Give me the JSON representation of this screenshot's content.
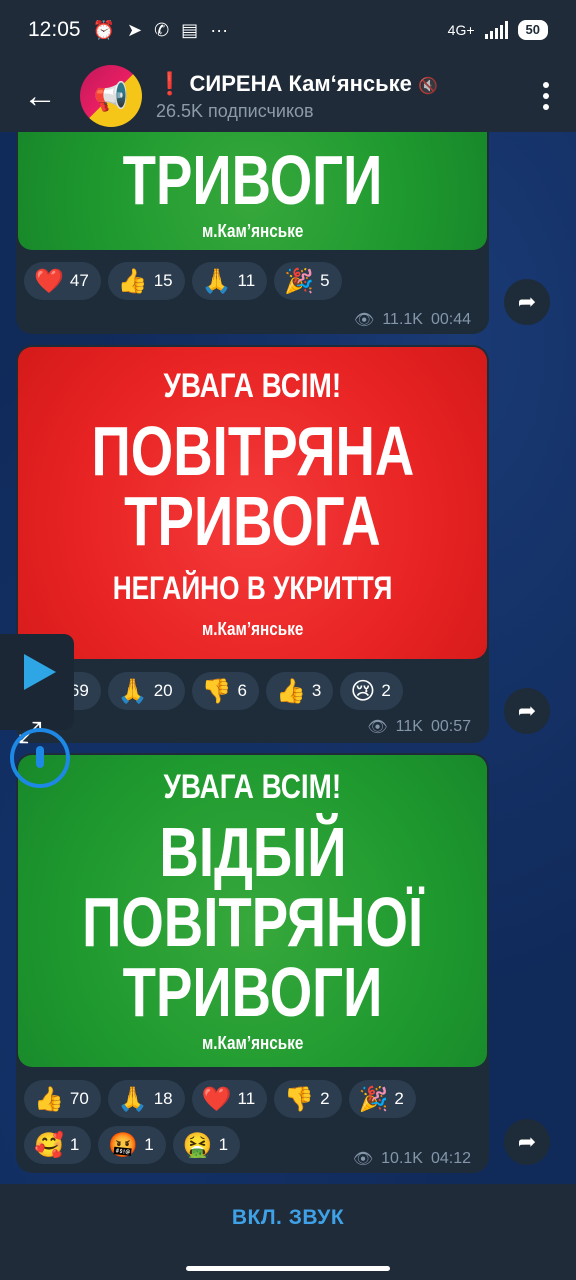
{
  "status_bar": {
    "time": "12:05",
    "icons": [
      "alarm-icon",
      "telegram-icon",
      "viber-icon",
      "news-icon",
      "more-dots-icon"
    ],
    "network": "4G+",
    "battery": "50"
  },
  "header": {
    "title_prefix": "❗",
    "title": "СИРЕНА Кам‘янське",
    "title_suffix": "🔇",
    "subscribers": "26.5K подписчиков"
  },
  "messages": [
    {
      "poster_color": "#1f9a2f",
      "lines": [
        "ТРИВОГИ"
      ],
      "city": "м.Кам’янське",
      "reactions": [
        {
          "emoji": "❤️",
          "count": "47"
        },
        {
          "emoji": "👍",
          "count": "15"
        },
        {
          "emoji": "🙏",
          "count": "11"
        },
        {
          "emoji": "🎉",
          "count": "5"
        }
      ],
      "views": "11.1K",
      "time": "00:44"
    },
    {
      "poster_color": "#e82323",
      "line1": "УВАГА ВСІМ!",
      "big": [
        "ПОВІТРЯНА",
        "ТРИВОГА"
      ],
      "mid": "НЕГАЙНО В УКРИТТЯ",
      "city": "м.Кам’янське",
      "reactions": [
        {
          "emoji": "🤬",
          "count": "69"
        },
        {
          "emoji": "🙏",
          "count": "20"
        },
        {
          "emoji": "👎",
          "count": "6"
        },
        {
          "emoji": "👍",
          "count": "3"
        },
        {
          "emoji": "😢",
          "count": "2"
        }
      ],
      "views": "11K",
      "time": "00:57"
    },
    {
      "poster_color": "#1f9a2f",
      "line1": "УВАГА ВСІМ!",
      "big": [
        "ВІДБІЙ",
        "ПОВІТРЯНОЇ",
        "ТРИВОГИ"
      ],
      "city": "м.Кам’янське",
      "reactions": [
        {
          "emoji": "👍",
          "count": "70"
        },
        {
          "emoji": "🙏",
          "count": "18"
        },
        {
          "emoji": "❤️",
          "count": "11"
        },
        {
          "emoji": "👎",
          "count": "2"
        },
        {
          "emoji": "🎉",
          "count": "2"
        },
        {
          "emoji": "🥰",
          "count": "1"
        },
        {
          "emoji": "🤬",
          "count": "1"
        },
        {
          "emoji": "🤮",
          "count": "1"
        }
      ],
      "views": "10.1K",
      "time": "04:12"
    }
  ],
  "bottom": {
    "sound_button": "ВКЛ. ЗВУК"
  }
}
